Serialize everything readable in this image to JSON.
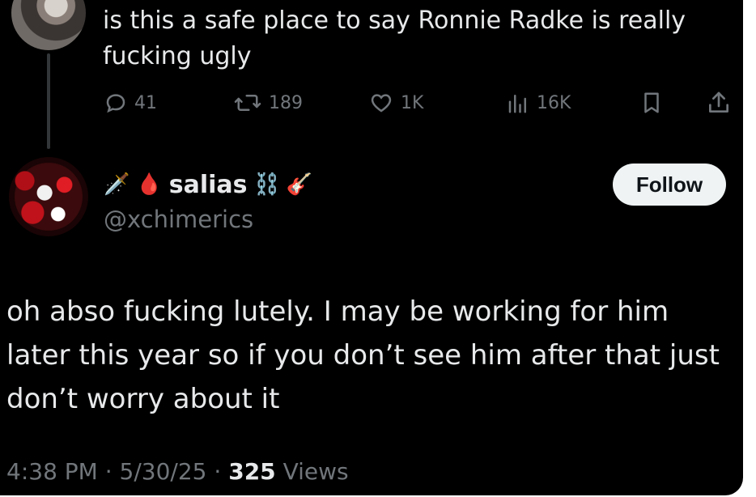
{
  "parent_post": {
    "text": "is this a safe place to say Ronnie Radke is really fucking ugly",
    "actions": {
      "replies": "41",
      "reposts": "189",
      "likes": "1K",
      "views": "16K"
    }
  },
  "reply_post": {
    "display_name": "salias",
    "handle": "@xchimerics",
    "follow_label": "Follow",
    "name_emoji_before": [
      "🗡️",
      "🩸"
    ],
    "name_emoji_after": [
      "⛓️",
      "🎸"
    ],
    "text": "oh abso fucking lutely. I may be working for him later this year so if you don’t see him after that just don’t worry about it",
    "time": "4:38 PM",
    "date": "5/30/25",
    "views_count": "325",
    "views_label": "Views"
  },
  "colors": {
    "background": "#000000",
    "text": "#e7e9ea",
    "muted": "#71767b",
    "follow_bg": "#eff3f4"
  }
}
